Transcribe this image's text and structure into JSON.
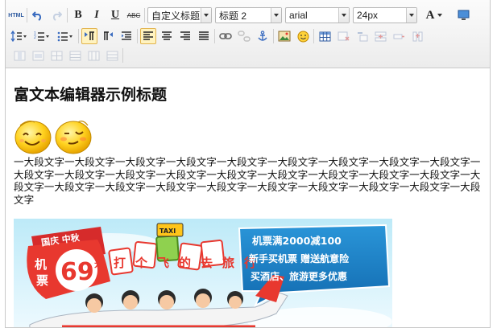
{
  "toolbar": {
    "html_label": "HTML",
    "bold_label": "B",
    "italic_label": "I",
    "underline_label": "U",
    "strike_label": "ABC",
    "custom_title": "自定义标题",
    "paragraph_format": "标题 2",
    "font_family": "arial",
    "font_size": "24px",
    "font_color_label": "A"
  },
  "document": {
    "title": "富文本编辑器示例标题",
    "paragraph": "一大段文字一大段文字一大段文字一大段文字一大段文字一大段文字一大段文字一大段文字一大段文字一大段文字一大段文字一大段文字一大段文字一大段文字一大段文字一大段文字一大段文字一大段文字一大段文字一大段文字一大段文字一大段文字一大段文字一大段文字一大段文字一大段文字一大段文字一大段文字"
  },
  "banner": {
    "tag_top": "国庆 中秋",
    "ticket_left": "机",
    "ticket_left2": "票",
    "price": "69",
    "price_unit": "元",
    "slogan": "打个飞的去旅行",
    "taxi": "TAXI",
    "bubble_line1": "机票满2000减100",
    "bubble_line2": "新手买机票 赠送航意险",
    "bubble_line3": "买酒店、旅游更多优惠"
  },
  "colors": {
    "accent_active": "#fff3c0",
    "banner_red": "#e8382f",
    "banner_blue": "#1a7fc1",
    "sky": "#cfeefa"
  },
  "icons": [
    "html-icon",
    "undo-icon",
    "redo-icon",
    "bold-icon",
    "italic-icon",
    "underline-icon",
    "strikethrough-icon",
    "font-color-icon",
    "fullscreen-icon",
    "line-height-icon",
    "ordered-list-icon",
    "unordered-list-icon",
    "ltr-icon",
    "rtl-icon",
    "indent-icon",
    "align-left-icon",
    "align-center-icon",
    "align-right-icon",
    "align-justify-icon",
    "link-icon",
    "unlink-icon",
    "anchor-icon",
    "image-icon",
    "emotion-icon",
    "table-icon"
  ]
}
